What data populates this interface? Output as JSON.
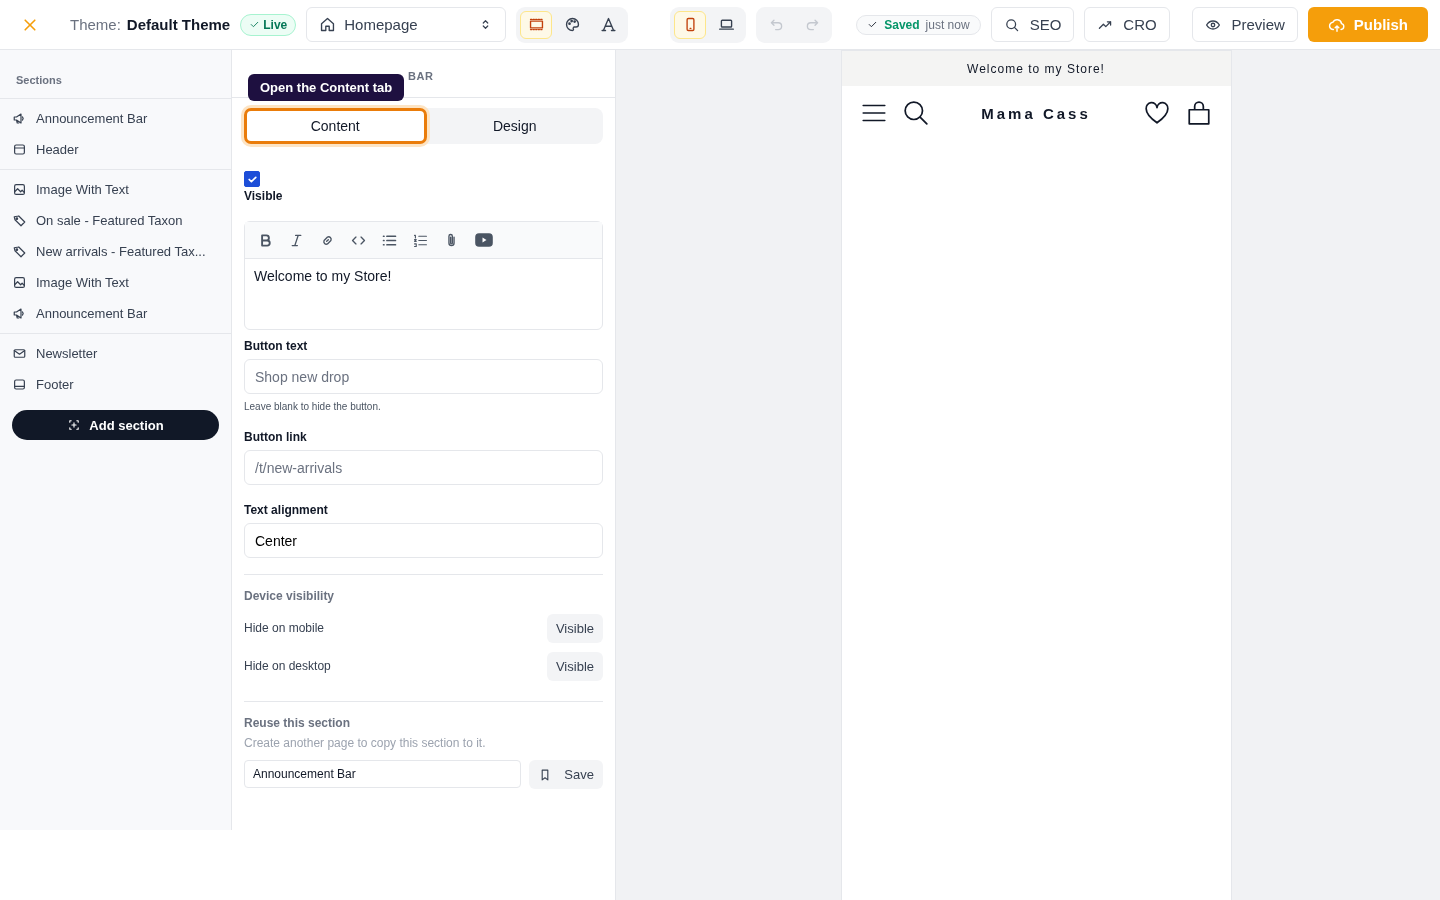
{
  "topbar": {
    "theme_label": "Theme:",
    "theme_name": "Default Theme",
    "status_badge": "Live",
    "page_select": "Homepage",
    "tool_tabs": [
      {
        "kind": "layout",
        "selected": true
      },
      {
        "kind": "palette",
        "selected": false
      },
      {
        "kind": "type",
        "selected": false
      }
    ],
    "device_tabs": [
      {
        "kind": "mobile",
        "selected": true
      },
      {
        "kind": "desktop",
        "selected": false
      }
    ],
    "history": [
      {
        "kind": "undo",
        "disabled": true
      },
      {
        "kind": "redo",
        "disabled": true
      }
    ],
    "save_status": {
      "label": "Saved",
      "time": "just now"
    },
    "buttons": [
      {
        "kind": "search",
        "label": "SEO"
      },
      {
        "kind": "trend",
        "label": "CRO"
      }
    ],
    "preview": "Preview",
    "publish": "Publish"
  },
  "sidebar": {
    "title": "Sections",
    "groups": [
      [
        {
          "kind": "megaphone",
          "label": "Announcement Bar"
        },
        {
          "kind": "panel-top",
          "label": "Header"
        }
      ],
      [
        {
          "kind": "image",
          "label": "Image With Text"
        },
        {
          "kind": "tag",
          "label": "On sale - Featured Taxon"
        },
        {
          "kind": "tag",
          "label": "New arrivals - Featured Tax..."
        },
        {
          "kind": "image",
          "label": "Image With Text"
        },
        {
          "kind": "megaphone",
          "label": "Announcement Bar"
        }
      ],
      [
        {
          "kind": "mail",
          "label": "Newsletter"
        },
        {
          "kind": "panel-bottom",
          "label": "Footer"
        }
      ]
    ],
    "add_button": "Add section"
  },
  "panel": {
    "header": "BAR",
    "tooltip": "Open the Content tab",
    "tabs": [
      {
        "label": "Content",
        "selected": true
      },
      {
        "label": "Design",
        "selected": false
      }
    ],
    "visible": {
      "label": "Visible",
      "checked": true
    },
    "editor": {
      "text": "Welcome to my Store!"
    },
    "fields": [
      {
        "label": "Button text",
        "placeholder": "Shop new drop",
        "help": "Leave blank to hide the button."
      },
      {
        "label": "Button link",
        "placeholder": "/t/new-arrivals"
      },
      {
        "label": "Text alignment",
        "value": "Center"
      }
    ],
    "device_visibility": {
      "title": "Device visibility",
      "rows": [
        {
          "label": "Hide on mobile",
          "value": "Visible"
        },
        {
          "label": "Hide on desktop",
          "value": "Visible"
        }
      ]
    },
    "reuse": {
      "title": "Reuse this section",
      "hint": "Create another page to copy this section to it.",
      "value": "Announcement Bar",
      "button": "Save"
    }
  },
  "store": {
    "announcement": "Welcome to my Store!",
    "name": "Mama Cass"
  }
}
